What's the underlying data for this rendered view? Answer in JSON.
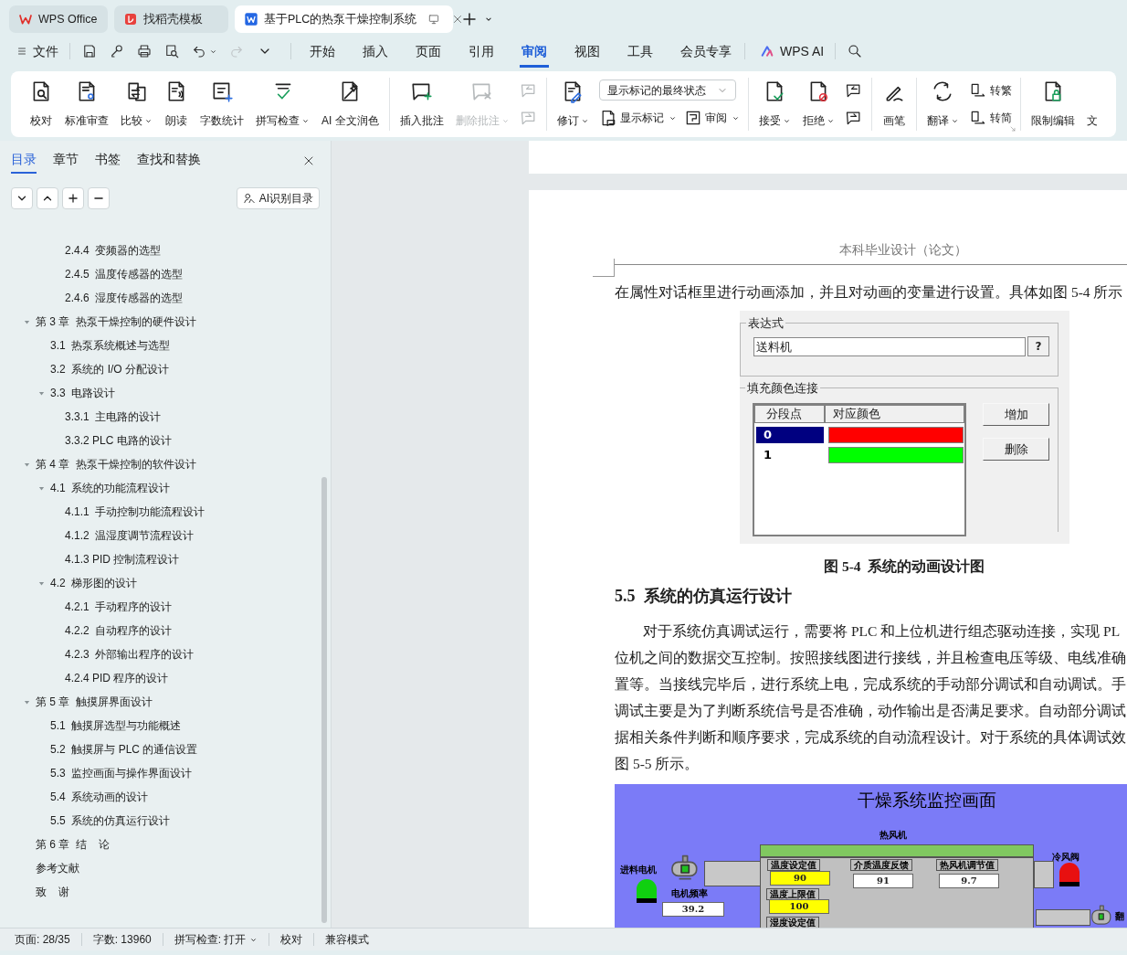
{
  "tabs": [
    {
      "label": "WPS Office",
      "selected": false
    },
    {
      "label": "找稻壳模板",
      "selected": false
    },
    {
      "label": "基于PLC的热泵干燥控制系统",
      "selected": true
    }
  ],
  "menu": {
    "file": "文件",
    "quick_access": [
      {
        "dropdown": false,
        "disabled": false
      },
      {
        "dropdown": false,
        "disabled": false
      },
      {
        "dropdown": false,
        "disabled": false
      },
      {
        "dropdown": false,
        "disabled": false
      },
      {
        "dropdown": true,
        "disabled": false
      },
      {
        "dropdown": false,
        "disabled": true
      }
    ],
    "tabs": [
      {
        "label": "开始",
        "selected": false
      },
      {
        "label": "插入",
        "selected": false
      },
      {
        "label": "页面",
        "selected": false
      },
      {
        "label": "引用",
        "selected": false
      },
      {
        "label": "审阅",
        "selected": true
      },
      {
        "label": "视图",
        "selected": false
      },
      {
        "label": "工具",
        "selected": false
      },
      {
        "label": "会员专享",
        "selected": false
      }
    ],
    "ai": "WPS AI"
  },
  "ribbon": {
    "groups": [
      {
        "launcher": false,
        "items": [
          {
            "kind": "large",
            "label": "校对",
            "dropdown": false,
            "disabled": false
          },
          {
            "kind": "large",
            "label": "标准审查",
            "dropdown": false,
            "disabled": false
          },
          {
            "kind": "large",
            "label": "比较",
            "dropdown": true,
            "disabled": false
          },
          {
            "kind": "large",
            "label": "朗读",
            "dropdown": false,
            "disabled": false
          },
          {
            "kind": "large",
            "label": "字数统计",
            "dropdown": false,
            "disabled": false
          },
          {
            "kind": "large",
            "label": "拼写检查",
            "dropdown": true,
            "disabled": false
          },
          {
            "kind": "large",
            "label": "AI 全文润色",
            "dropdown": false,
            "disabled": false
          }
        ]
      },
      {
        "launcher": false,
        "items": [
          {
            "kind": "large",
            "label": "插入批注",
            "dropdown": false,
            "disabled": false
          },
          {
            "kind": "large",
            "label": "删除批注",
            "dropdown": true,
            "disabled": true
          },
          {
            "kind": "stack",
            "items": [
              {
                "kind": "small",
                "dropdown": false,
                "disabled": true
              },
              {
                "kind": "small",
                "dropdown": false,
                "disabled": true
              }
            ]
          }
        ]
      },
      {
        "launcher": false,
        "items": [
          {
            "kind": "large",
            "label": "修订",
            "dropdown": true,
            "disabled": false
          },
          {
            "kind": "stack",
            "items": [
              {
                "kind": "select",
                "value": "显示标记的最终状态"
              },
              {
                "kind": "row",
                "items": [
                  {
                    "kind": "small",
                    "label": "显示标记",
                    "dropdown": true,
                    "disabled": false
                  },
                  {
                    "kind": "small",
                    "label": "审阅",
                    "dropdown": true,
                    "disabled": false
                  }
                ]
              }
            ]
          }
        ]
      },
      {
        "launcher": false,
        "items": [
          {
            "kind": "large",
            "label": "接受",
            "dropdown": true,
            "disabled": false
          },
          {
            "kind": "large",
            "label": "拒绝",
            "dropdown": true,
            "disabled": false
          },
          {
            "kind": "stack",
            "items": [
              {
                "kind": "small",
                "dropdown": false,
                "disabled": false
              },
              {
                "kind": "small",
                "dropdown": false,
                "disabled": false
              }
            ]
          }
        ]
      },
      {
        "launcher": false,
        "items": [
          {
            "kind": "large",
            "label": "画笔",
            "dropdown": false,
            "disabled": false
          }
        ]
      },
      {
        "launcher": true,
        "items": [
          {
            "kind": "large",
            "label": "翻译",
            "dropdown": true,
            "disabled": false
          },
          {
            "kind": "stack",
            "items": [
              {
                "kind": "small",
                "label": "转繁",
                "dropdown": false,
                "disabled": false
              },
              {
                "kind": "small",
                "label": "转简",
                "dropdown": false,
                "disabled": false
              }
            ]
          }
        ]
      },
      {
        "launcher": false,
        "items": [
          {
            "kind": "large",
            "label": "限制编辑",
            "dropdown": false,
            "disabled": false
          },
          {
            "kind": "large",
            "label": "文",
            "dropdown": false,
            "disabled": false
          }
        ]
      }
    ]
  },
  "sidebar": {
    "tabs": [
      {
        "label": "目录",
        "selected": true
      },
      {
        "label": "章节",
        "selected": false
      },
      {
        "label": "书签",
        "selected": false
      },
      {
        "label": "查找和替换",
        "selected": false
      }
    ],
    "ai_button": "AI识别目录",
    "toc": [
      {
        "children": [
          {
            "children": [
              {
                "label": "2.4.4  变频器的选型"
              },
              {
                "label": "2.4.5  温度传感器的选型"
              },
              {
                "label": "2.4.6  湿度传感器的选型"
              }
            ]
          }
        ]
      },
      {
        "label": "第 3 章  热泵干燥控制的硬件设计",
        "expanded": true,
        "children": [
          {
            "label": "3.1  热泵系统概述与选型"
          },
          {
            "label": "3.2  系统的 I/O 分配设计"
          },
          {
            "label": "3.3  电路设计",
            "expanded": true,
            "children": [
              {
                "label": "3.3.1  主电路的设计"
              },
              {
                "label": "3.3.2 PLC 电路的设计"
              }
            ]
          }
        ]
      },
      {
        "label": "第 4 章  热泵干燥控制的软件设计",
        "expanded": true,
        "children": [
          {
            "label": "4.1  系统的功能流程设计",
            "expanded": true,
            "children": [
              {
                "label": "4.1.1  手动控制功能流程设计"
              },
              {
                "label": "4.1.2  温湿度调节流程设计"
              },
              {
                "label": "4.1.3 PID 控制流程设计"
              }
            ]
          },
          {
            "label": "4.2  梯形图的设计",
            "expanded": true,
            "children": [
              {
                "label": "4.2.1  手动程序的设计"
              },
              {
                "label": "4.2.2  自动程序的设计"
              },
              {
                "label": "4.2.3  外部输出程序的设计"
              },
              {
                "label": "4.2.4 PID 程序的设计"
              }
            ]
          }
        ]
      },
      {
        "label": "第 5 章  触摸屏界面设计",
        "expanded": true,
        "children": [
          {
            "label": "5.1  触摸屏选型与功能概述"
          },
          {
            "label": "5.2  触摸屏与 PLC 的通信设置"
          },
          {
            "label": "5.3  监控画面与操作界面设计"
          },
          {
            "label": "5.4  系统动画的设计"
          },
          {
            "label": "5.5  系统的仿真运行设计"
          }
        ]
      },
      {
        "label": "第 6 章  结    论"
      },
      {
        "label": "参考文献"
      },
      {
        "label": "致    谢"
      }
    ]
  },
  "document": {
    "header": "本科毕业设计（论文）",
    "intro": "在属性对话框里进行动画添加，并且对动画的变量进行设置。具体如图 5-4 所示",
    "figure": {
      "expression_legend": "表达式",
      "expression": "送料机",
      "help_button": "?",
      "fill_legend": "填充颜色连接",
      "columns": [
        "分段点",
        "对应颜色"
      ],
      "rows": [
        {
          "point": "0",
          "color": "#ff0000",
          "selected": true
        },
        {
          "point": "1",
          "color": "#00ff00",
          "selected": false
        }
      ],
      "buttons": [
        "增加",
        "删除"
      ]
    },
    "caption": "图 5-4  系统的动画设计图",
    "heading": "5.5  系统的仿真运行设计",
    "paragraph_lines": [
      "对于系统仿真调试运行，需要将 PLC 和上位机进行组态驱动连接，实现 PL",
      "位机之间的数据交互控制。按照接线图进行接线，并且检查电压等级、电线准确",
      "置等。当接线完毕后，进行系统上电，完成系统的手动部分调试和自动调试。手",
      "调试主要是为了判断系统信号是否准确，动作输出是否满足要求。自动部分调试",
      "据相关条件判断和顺序要求，完成系统的自动流程设计。对于系统的具体调试效",
      "图 5-5 所示。"
    ],
    "monitor_screen": {
      "title": "干燥系统监控画面",
      "heater_label": "热风机",
      "feed_motor_label": "进料电机",
      "frequency_label": "电机频率",
      "frequency": "39.2",
      "panel_fields": [
        {
          "label": "温度设定值",
          "value": "90",
          "highlighted": true
        },
        {
          "label": "温度上限值",
          "value": "100",
          "highlighted": true
        },
        {
          "label": "湿度设定值"
        },
        {
          "label": "介质温度反馈",
          "value": "91",
          "highlighted": false
        },
        {
          "label": "热风机调节值",
          "value": "9.7",
          "highlighted": false
        }
      ],
      "cold_valve_label": "冷风阀",
      "edge_label": "翻",
      "lamps": [
        {
          "color": "#10d010"
        },
        {
          "color": "#e81010"
        }
      ]
    }
  },
  "status_bar": [
    {
      "label": "页面: 28/35",
      "dropdown": false
    },
    {
      "label": "字数: 13960",
      "dropdown": false
    },
    {
      "label": "拼写检查: 打开",
      "dropdown": true
    },
    {
      "label": "校对",
      "dropdown": false
    },
    {
      "label": "兼容模式",
      "dropdown": false
    }
  ]
}
